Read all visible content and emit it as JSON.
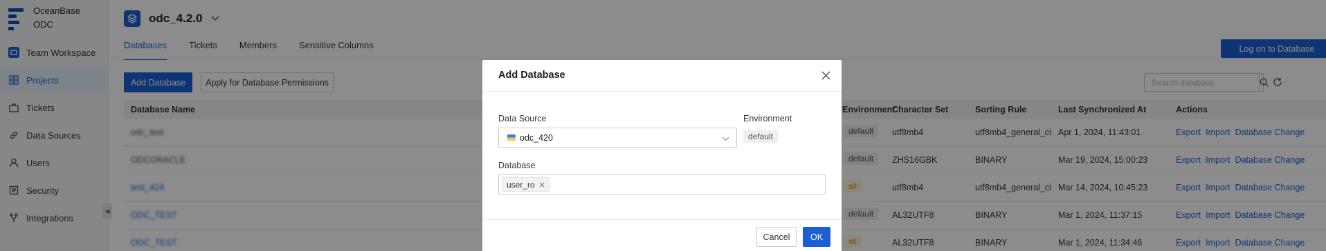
{
  "brand": {
    "line1": "OceanBase",
    "line2": "ODC"
  },
  "sidebar": {
    "workspace": "Team Workspace",
    "items": [
      {
        "label": "Projects",
        "icon": "grid-icon",
        "active": true
      },
      {
        "label": "Tickets",
        "icon": "briefcase-icon"
      },
      {
        "label": "Data Sources",
        "icon": "link-icon"
      },
      {
        "label": "Users",
        "icon": "user-icon"
      },
      {
        "label": "Security",
        "icon": "shield-icon"
      },
      {
        "label": "Integrations",
        "icon": "fork-icon"
      }
    ]
  },
  "project": {
    "name": "odc_4.2.0"
  },
  "tabs": [
    "Databases",
    "Tickets",
    "Members",
    "Sensitive Columns"
  ],
  "toolbar": {
    "login": "Log on to Database",
    "add_db": "Add Database",
    "apply_perm": "Apply for Database Permissions",
    "search_placeholder": "Search database"
  },
  "table": {
    "headers": [
      "Database Name",
      "Environment",
      "Character Set",
      "Sorting Rule",
      "Last Synchronized At",
      "Actions"
    ],
    "rows": [
      {
        "name": "odc_test",
        "env": "default",
        "charset": "utf8mb4",
        "collation": "utf8mb4_general_ci",
        "synced": "Apr 1, 2024, 11:43:01"
      },
      {
        "name": "ODCORACLE",
        "env": "default",
        "charset": "ZHS16GBK",
        "collation": "BINARY",
        "synced": "Mar 19, 2024, 15:00:23"
      },
      {
        "name": "test_424",
        "env": "sit",
        "charset": "utf8mb4",
        "collation": "utf8mb4_general_ci",
        "synced": "Mar 14, 2024, 10:45:23"
      },
      {
        "name": "ODC_TEST",
        "env": "default",
        "charset": "AL32UTF8",
        "collation": "BINARY",
        "synced": "Mar 1, 2024, 11:37:15"
      },
      {
        "name": "ODC_TEST",
        "env": "sit",
        "charset": "AL32UTF8",
        "collation": "BINARY",
        "synced": "Mar 1, 2024, 11:34:46"
      }
    ],
    "actions": {
      "export": "Export",
      "import": "Import",
      "change": "Database Change"
    }
  },
  "modal": {
    "title": "Add Database",
    "data_source_label": "Data Source",
    "data_source_value": "odc_420",
    "environment_label": "Environment",
    "environment_value": "default",
    "database_label": "Database",
    "database_tag": "user_ro",
    "cancel": "Cancel",
    "ok": "OK"
  },
  "colors": {
    "primary": "#1b5fd4",
    "mask": "rgba(0,0,0,0.45)"
  }
}
